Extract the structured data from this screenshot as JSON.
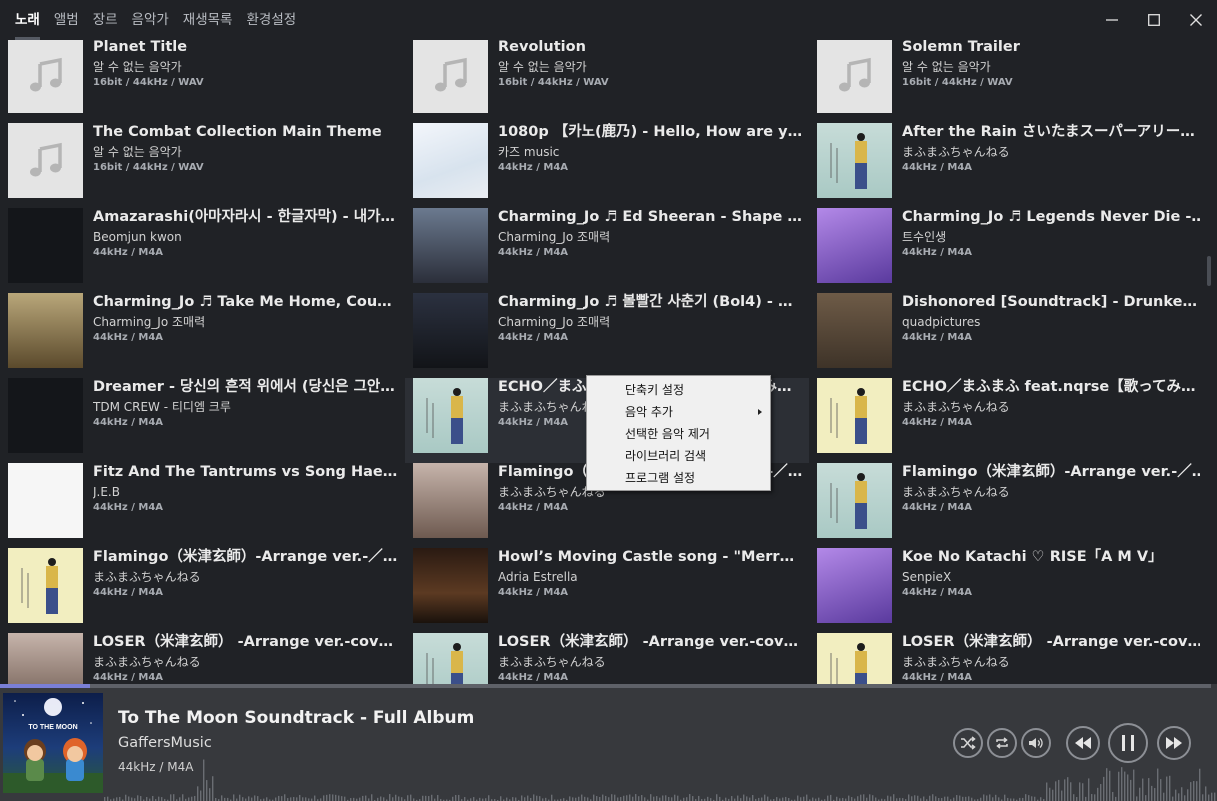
{
  "nav": {
    "tabs": [
      "노래",
      "앨범",
      "장르",
      "음악가",
      "재생목록",
      "환경설정"
    ],
    "active": 0
  },
  "songs": [
    {
      "title": "Planet Title",
      "artist": "알 수 없는 음악가",
      "format": "16bit / 44kHz / WAV",
      "thumb": "music-note"
    },
    {
      "title": "Revolution",
      "artist": "알 수 없는 음악가",
      "format": "16bit / 44kHz / WAV",
      "thumb": "music-note"
    },
    {
      "title": "Solemn Trailer",
      "artist": "알 수 없는 음악가",
      "format": "16bit / 44kHz / WAV",
      "thumb": "music-note"
    },
    {
      "title": "The Combat Collection Main Theme",
      "artist": "알 수 없는 음악가",
      "format": "16bit / 44kHz / WAV",
      "thumb": "music-note"
    },
    {
      "title": "1080p 【카노(鹿乃) - Hello, How are you…",
      "artist": "카즈 music",
      "format": "44kHz / M4A",
      "thumb": "sky"
    },
    {
      "title": "After the Rain さいたまスーパーアリー…",
      "artist": "まふまふちゃんねる",
      "format": "44kHz / M4A",
      "thumb": "mint"
    },
    {
      "title": "Amazarashi(아마자라시 - 한글자막) - 내가…",
      "artist": "Beomjun kwon",
      "format": "44kHz / M4A",
      "thumb": "dark"
    },
    {
      "title": "Charming_Jo ♬ Ed Sheeran - Shape Of…",
      "artist": "Charming_Jo 조매력",
      "format": "44kHz / M4A",
      "thumb": "studio"
    },
    {
      "title": "Charming_Jo ♬ Legends Never Die - Le…",
      "artist": "트수인생",
      "format": "44kHz / M4A",
      "thumb": "purple"
    },
    {
      "title": "Charming_Jo ♬ Take Me Home, Country…",
      "artist": "Charming_Jo 조매력",
      "format": "44kHz / M4A",
      "thumb": "olive"
    },
    {
      "title": "Charming_Jo ♬ 볼빨간 사춘기 (Bol4) - 여…",
      "artist": "Charming_Jo 조매력",
      "format": "44kHz / M4A",
      "thumb": "night"
    },
    {
      "title": "Dishonored [Soundtrack] - Drunken Wh…",
      "artist": "quadpictures",
      "format": "44kHz / M4A",
      "thumb": "brown"
    },
    {
      "title": "Dreamer - 당신의 흔적 위에서 (당신은 그안…",
      "artist": "TDM CREW - 티디엠 크루",
      "format": "44kHz / M4A",
      "thumb": "dark"
    },
    {
      "title": "ECHO／まふまふ feat.nqrse【歌ってみた】",
      "artist": "まふまふちゃんねる",
      "format": "44kHz / M4A",
      "thumb": "mint"
    },
    {
      "title": "ECHO／まふまふ feat.nqrse【歌ってみた】",
      "artist": "まふまふちゃんねる",
      "format": "44kHz / M4A",
      "thumb": "paper"
    },
    {
      "title": "Fitz And The Tantrums vs Song Hae - 전…",
      "artist": "J.E.B",
      "format": "44kHz / M4A",
      "thumb": "white"
    },
    {
      "title": "Flamingo（米津玄師）-Arrange ver.-／…",
      "artist": "まふまふちゃんねる",
      "format": "44kHz / M4A",
      "thumb": "rose"
    },
    {
      "title": "Flamingo（米津玄師）-Arrange ver.-／…",
      "artist": "まふまふちゃんねる",
      "format": "44kHz / M4A",
      "thumb": "mint"
    },
    {
      "title": "Flamingo（米津玄師）-Arrange ver.-／…",
      "artist": "まふまふちゃんねる",
      "format": "44kHz / M4A",
      "thumb": "paper"
    },
    {
      "title": "Howl’s Moving Castle song - \"Merry-Go…",
      "artist": "Adria Estrella",
      "format": "44kHz / M4A",
      "thumb": "concert"
    },
    {
      "title": "Koe No Katachi ♡ RISE「A M V」",
      "artist": "SenpieX",
      "format": "44kHz / M4A",
      "thumb": "purple"
    },
    {
      "title": "LOSER（米津玄師） -Arrange ver.-cover…",
      "artist": "まふまふちゃんねる",
      "format": "44kHz / M4A",
      "thumb": "rose"
    },
    {
      "title": "LOSER（米津玄師） -Arrange ver.-cover…",
      "artist": "まふまふちゃんねる",
      "format": "44kHz / M4A",
      "thumb": "mint"
    },
    {
      "title": "LOSER（米津玄師） -Arrange ver.-cover…",
      "artist": "まふまふちゃんねる",
      "format": "44kHz / M4A",
      "thumb": "paper"
    }
  ],
  "highlighted_index": 13,
  "context_menu": {
    "items": [
      {
        "label": "단축키 설정",
        "submenu": false
      },
      {
        "label": "음악 추가",
        "submenu": true
      },
      {
        "label": "선택한 음악 제거",
        "submenu": false
      },
      {
        "label": "라이브러리 검색",
        "submenu": false
      },
      {
        "label": "프로그램 설정",
        "submenu": false
      }
    ]
  },
  "player": {
    "title": "To The Moon Soundtrack - Full Album",
    "artist": "GaffersMusic",
    "format": "44kHz / M4A",
    "cover_text": "TO THE MOON",
    "progress": 0.074,
    "controls": [
      "shuffle-icon",
      "repeat-icon",
      "volume-icon",
      "previous-icon",
      "pause-icon",
      "next-icon"
    ]
  }
}
